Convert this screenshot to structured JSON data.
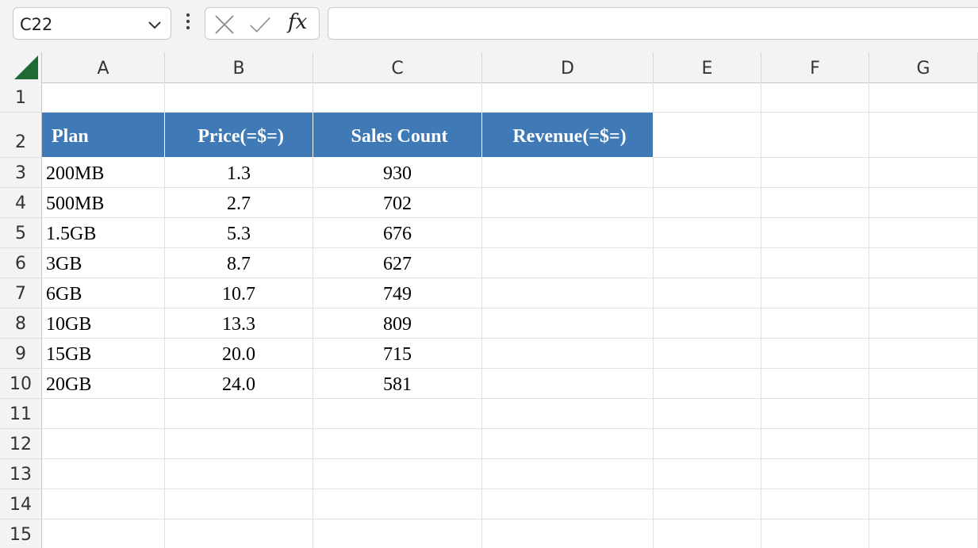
{
  "name_box": {
    "value": "C22"
  },
  "formula_bar": {
    "fx_label": "fx",
    "value": ""
  },
  "icons": {
    "name_box_dropdown": "chevron-down-icon",
    "more_options": "vertical-ellipsis-icon",
    "cancel": "close-icon",
    "enter": "checkmark-icon",
    "insert_function": "fx-icon",
    "select_all": "select-all-triangle-icon"
  },
  "colors": {
    "header_fill": "#3f7ab6",
    "header_text": "#ffffff",
    "select_all": "#1e6b34"
  },
  "columns": [
    "A",
    "B",
    "C",
    "D",
    "E",
    "F",
    "G"
  ],
  "rows": [
    "1",
    "2",
    "3",
    "4",
    "5",
    "6",
    "7",
    "8",
    "9",
    "10",
    "11",
    "12",
    "13",
    "14",
    "15"
  ],
  "table": {
    "headers": [
      "Plan",
      "Price(=$=)",
      "Sales Count",
      "Revenue(=$=)"
    ],
    "data": [
      [
        "200MB",
        "1.3",
        "930",
        ""
      ],
      [
        "500MB",
        "2.7",
        "702",
        ""
      ],
      [
        "1.5GB",
        "5.3",
        "676",
        ""
      ],
      [
        "3GB",
        "8.7",
        "627",
        ""
      ],
      [
        "6GB",
        "10.7",
        "749",
        ""
      ],
      [
        "10GB",
        "13.3",
        "809",
        ""
      ],
      [
        "15GB",
        "20.0",
        "715",
        ""
      ],
      [
        "20GB",
        "24.0",
        "581",
        ""
      ]
    ]
  }
}
